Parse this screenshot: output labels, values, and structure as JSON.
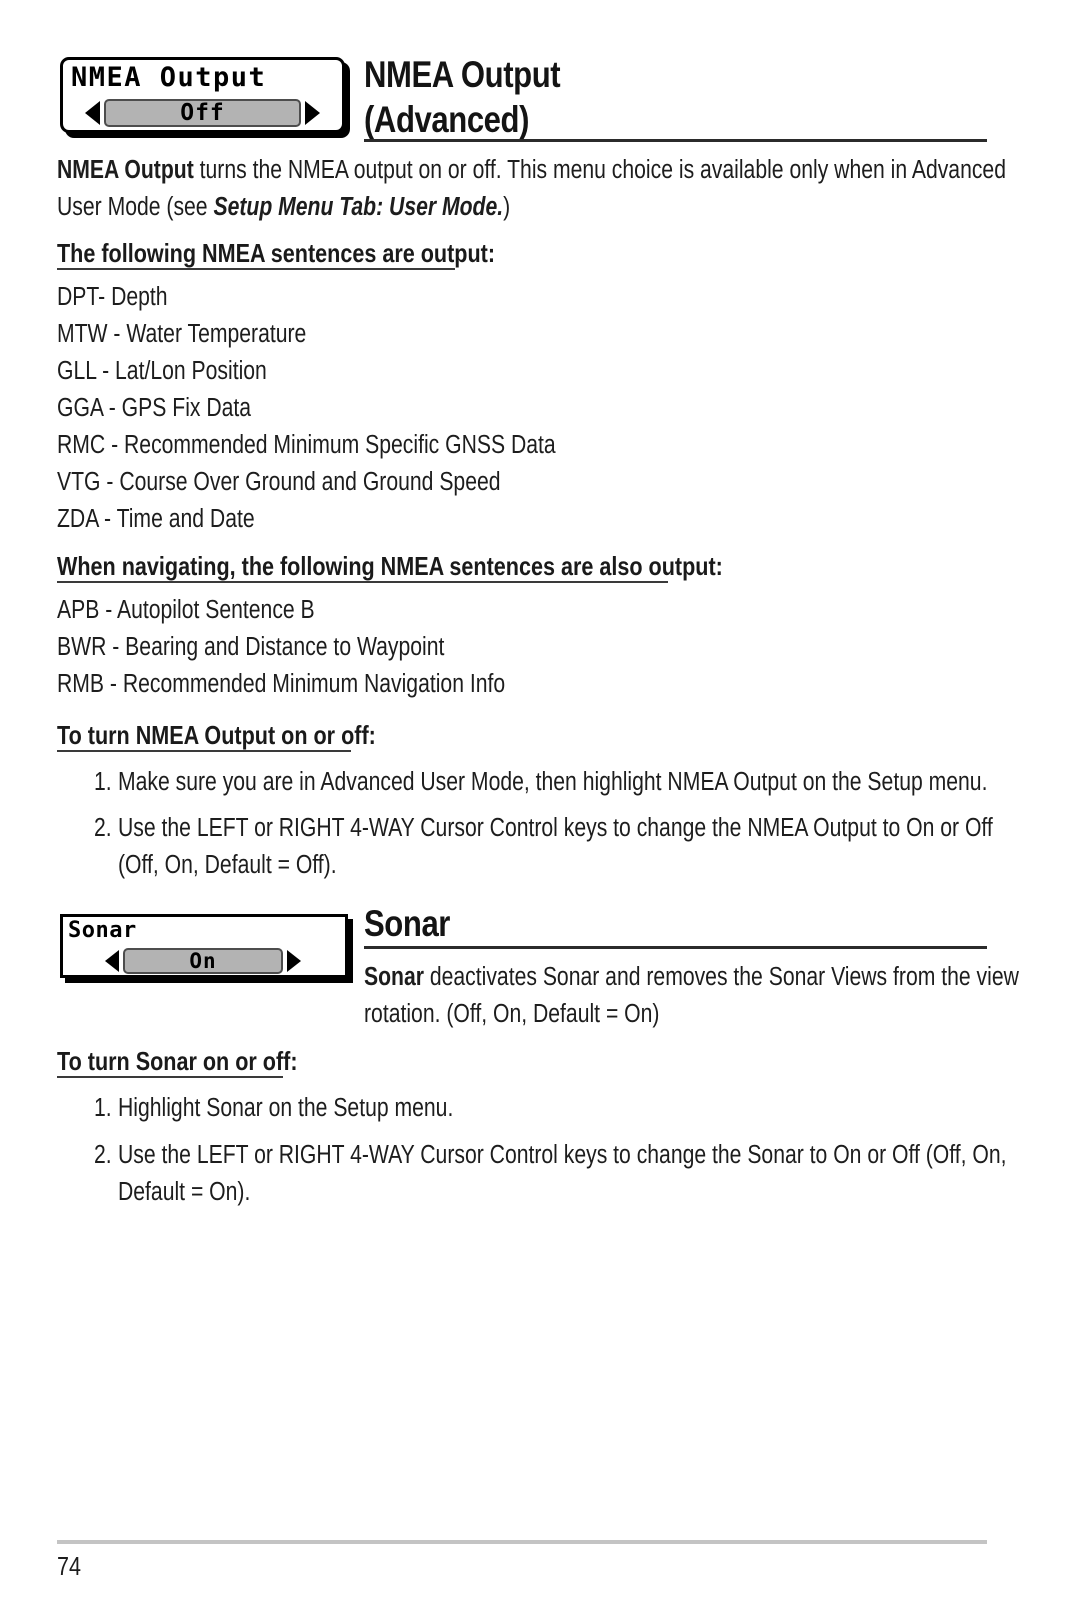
{
  "page": {
    "number": "74",
    "background": "#ffffff",
    "text_color": "#1d1d1d"
  },
  "sections": [
    {
      "id": "nmea-output",
      "widget": {
        "label": "NMEA Output",
        "value": "Off",
        "left_arrow": "left-arrow-icon",
        "right_arrow": "right-arrow-icon",
        "value_bg": "#b3b3b3"
      },
      "title": "NMEA Output",
      "subtitle": "(Advanced)",
      "intro": {
        "line1_bold": "NMEA Output",
        "line1_rest": " turns the NMEA output on or off.  This menu choice is available only when in Advanced",
        "line2_pre": "User Mode (see ",
        "line2_bolditalic": "Setup Menu Tab: User Mode.",
        "line2_post": ")"
      },
      "sentences_heading": "The following NMEA sentences are output:",
      "sentences": [
        "DPT- Depth",
        "MTW - Water Temperature",
        "GLL - Lat/Lon Position",
        "GGA - GPS Fix Data",
        "RMC - Recommended Minimum Specific GNSS Data",
        "VTG - Course Over Ground and Ground Speed",
        "ZDA - Time and Date"
      ],
      "nav_heading": "When navigating, the following NMEA sentences are also output:",
      "nav_sentences": [
        "APB - Autopilot Sentence B",
        "BWR - Bearing and Distance to Waypoint",
        "RMB - Recommended Minimum Navigation Info"
      ],
      "steps_heading": "To turn NMEA Output on or off:",
      "steps": [
        {
          "number": "1.",
          "lines": [
            "Make sure you are in Advanced User Mode, then highlight NMEA Output on the Setup menu."
          ]
        },
        {
          "number": "2.",
          "lines": [
            "Use the LEFT or RIGHT 4-WAY Cursor Control keys to change the NMEA Output to On or Off",
            "(Off, On, Default = Off)."
          ]
        }
      ]
    },
    {
      "id": "sonar",
      "widget": {
        "label": "Sonar",
        "value": "On",
        "left_arrow": "left-arrow-icon",
        "right_arrow": "right-arrow-icon",
        "value_bg": "#b3b3b3"
      },
      "title": "Sonar",
      "intro": {
        "line1_bold": "Sonar",
        "line1_rest": " deactivates Sonar and removes the Sonar Views from the view",
        "line2": "rotation. (Off, On, Default = On)"
      },
      "steps_heading": "To turn Sonar on or off:",
      "steps": [
        {
          "number": "1.",
          "lines": [
            "Highlight Sonar on the Setup menu."
          ]
        },
        {
          "number": "2.",
          "lines": [
            "Use the LEFT or RIGHT 4-WAY Cursor Control keys to change the Sonar to On or Off (Off, On,",
            "Default = On)."
          ]
        }
      ]
    }
  ]
}
